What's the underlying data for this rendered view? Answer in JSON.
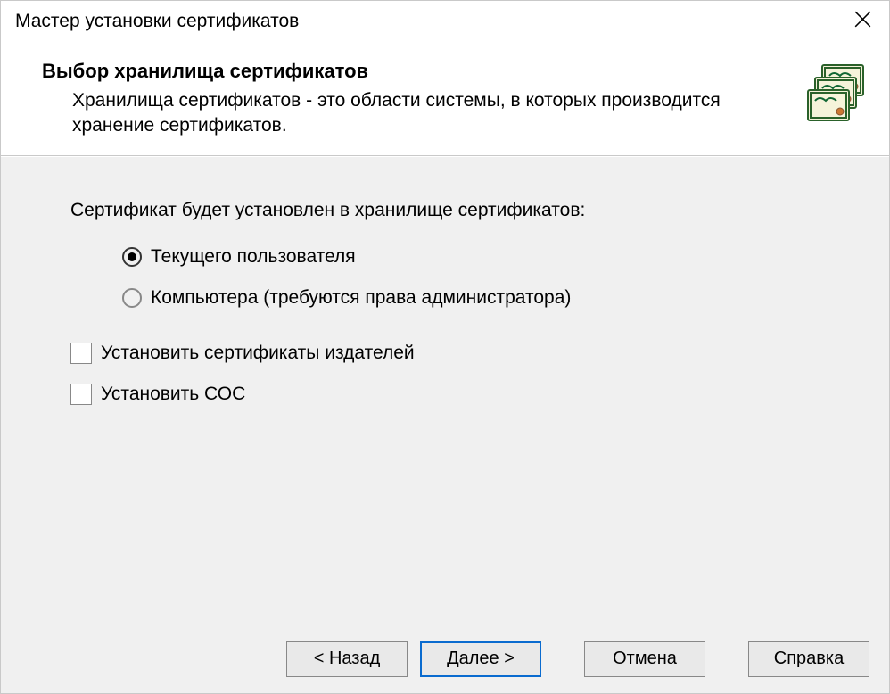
{
  "window": {
    "title": "Мастер установки сертификатов"
  },
  "header": {
    "title": "Выбор хранилища сертификатов",
    "description": "Хранилища сертификатов - это области системы, в которых производится хранение сертификатов."
  },
  "body": {
    "prompt": "Сертификат будет установлен в хранилище сертификатов:",
    "radios": [
      {
        "label": "Текущего пользователя",
        "checked": true
      },
      {
        "label": "Компьютера (требуются права администратора)",
        "checked": false
      }
    ],
    "checks": [
      {
        "label": "Установить сертификаты издателей",
        "checked": false
      },
      {
        "label": "Установить СОС",
        "checked": false
      }
    ]
  },
  "footer": {
    "back": "< Назад",
    "next": "Далее >",
    "cancel": "Отмена",
    "help": "Справка"
  }
}
